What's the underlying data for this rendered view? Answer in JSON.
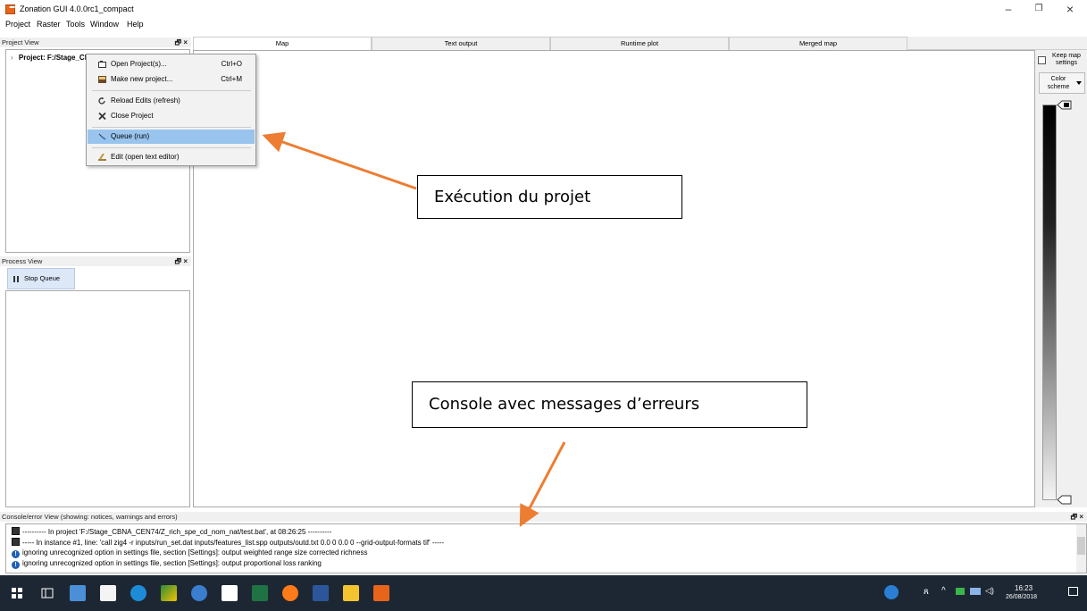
{
  "window": {
    "title": "Zonation GUI 4.0.0rc1_compact",
    "controls": {
      "minimize": "–",
      "maximize": "❐",
      "close": "×"
    }
  },
  "menubar": [
    "Project",
    "Raster",
    "Tools",
    "Window",
    "Help"
  ],
  "project_view": {
    "title": "Project View",
    "controls": "🗗 ×",
    "tree_item": "Project: F:/Stage_CB"
  },
  "context_menu": {
    "items": [
      {
        "label": "Open Project(s)...",
        "shortcut": "Ctrl+O",
        "icon": "folder-open-icon"
      },
      {
        "label": "Make new project...",
        "shortcut": "Ctrl+M",
        "icon": "new-project-icon"
      },
      {
        "label": "Reload Edits (refresh)",
        "shortcut": "",
        "icon": "reload-icon"
      },
      {
        "label": "Close Project",
        "shortcut": "",
        "icon": "close-project-icon"
      },
      {
        "label": "Queue (run)",
        "shortcut": "",
        "icon": "queue-run-icon"
      },
      {
        "label": "Edit (open text editor)",
        "shortcut": "",
        "icon": "edit-icon"
      }
    ]
  },
  "process_view": {
    "title": "Process View",
    "controls": "🗗 ×",
    "stop_queue": "Stop Queue"
  },
  "tabs": [
    "Map",
    "Text output",
    "Runtime plot",
    "Merged map"
  ],
  "right_panel": {
    "keep_map": "Keep map settings",
    "color_scheme": "Color scheme"
  },
  "console": {
    "title": "Console/error View (showing: notices, warnings and errors)",
    "controls": "🗗 ×",
    "lines": [
      {
        "icon": "zonation-icon",
        "text": "---------- In project 'F:/Stage_CBNA_CEN74/Z_rich_spe_cd_nom_nat/test.bat', at 08:26:25 ----------"
      },
      {
        "icon": "zonation-icon",
        "text": "----- In instance #1, line: 'call zig4 -r inputs/run_set.dat inputs/features_list.spp outputs/outd.txt 0.0 0 0.0 0 --grid-output-formats tif' -----"
      },
      {
        "icon": "info-icon",
        "text": "ignoring unrecognized option in settings file, section [Settings]: output weighted range size corrected richness"
      },
      {
        "icon": "info-icon",
        "text": "ignoring unrecognized option in settings file, section [Settings]: output proportional loss ranking"
      }
    ]
  },
  "annotations": {
    "execution": "Exécution du projet",
    "console": "Console avec messages d’erreurs",
    "arrow_color": "#ed7d31"
  },
  "taskbar": {
    "time": "16:23",
    "date": "26/08/2018"
  }
}
